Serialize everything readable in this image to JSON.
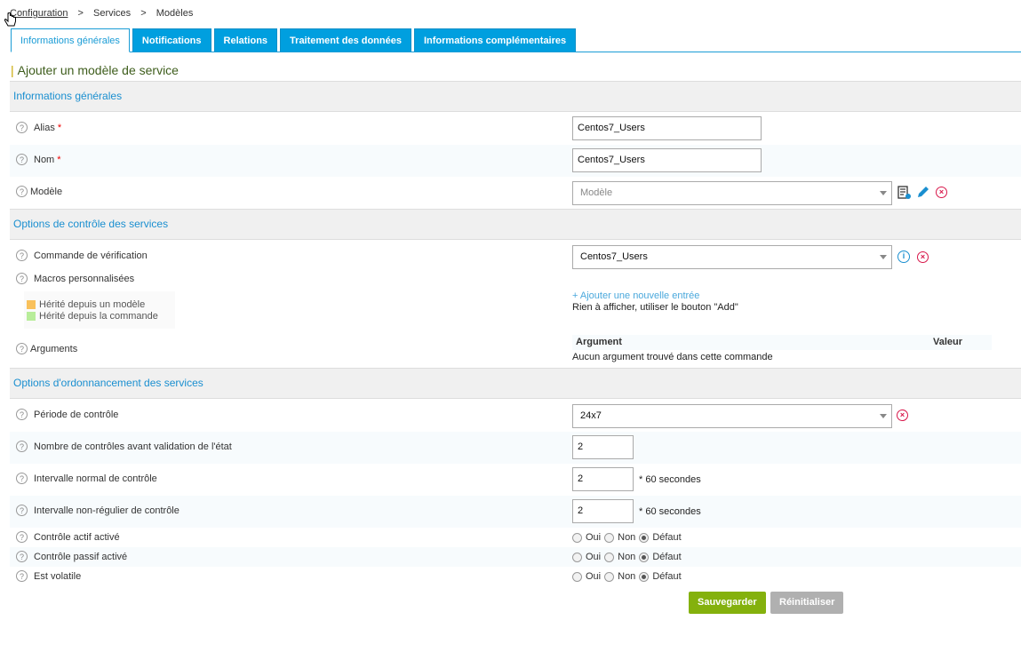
{
  "breadcrumb": {
    "root": "Configuration",
    "sep": ">",
    "level2": "Services",
    "level3": "Modèles"
  },
  "tabs": [
    {
      "label": "Informations générales",
      "active": true
    },
    {
      "label": "Notifications"
    },
    {
      "label": "Relations"
    },
    {
      "label": "Traitement des données"
    },
    {
      "label": "Informations complémentaires"
    }
  ],
  "page_title": "Ajouter un modèle de service",
  "sections": {
    "general": "Informations générales",
    "check": "Options de contrôle des services",
    "schedule": "Options d'ordonnancement des services"
  },
  "fields": {
    "alias": {
      "label": "Alias",
      "value": "Centos7_Users"
    },
    "name": {
      "label": "Nom",
      "value": "Centos7_Users"
    },
    "template": {
      "label": "Modèle",
      "placeholder": "Modèle"
    },
    "check_command": {
      "label": "Commande de vérification",
      "value": "Centos7_Users"
    },
    "macros": {
      "label": "Macros personnalisées",
      "add_link": "+ Ajouter une nouvelle entrée",
      "empty": "Rien à afficher, utiliser le bouton \"Add\""
    },
    "legend": {
      "from_template": "Hérité depuis un modèle",
      "from_command": "Hérité depuis la commande"
    },
    "arguments": {
      "label": "Arguments",
      "col_argument": "Argument",
      "col_value": "Valeur",
      "empty": "Aucun argument trouvé dans cette commande"
    },
    "check_period": {
      "label": "Période de contrôle",
      "value": "24x7"
    },
    "max_attempts": {
      "label": "Nombre de contrôles avant validation de l'état",
      "value": "2"
    },
    "normal_interval": {
      "label": "Intervalle normal de contrôle",
      "value": "2",
      "unit": "* 60 secondes"
    },
    "retry_interval": {
      "label": "Intervalle non-régulier de contrôle",
      "value": "2",
      "unit": "* 60 secondes"
    },
    "active_checks": {
      "label": "Contrôle actif activé"
    },
    "passive_checks": {
      "label": "Contrôle passif activé"
    },
    "volatile": {
      "label": "Est volatile"
    }
  },
  "radio_options": {
    "yes": "Oui",
    "no": "Non",
    "default": "Défaut"
  },
  "buttons": {
    "save": "Sauvegarder",
    "reset": "Réinitialiser"
  },
  "colors": {
    "accent": "#009fdf",
    "save": "#84b10d",
    "required": "#e00000",
    "delete": "#d8174a"
  }
}
